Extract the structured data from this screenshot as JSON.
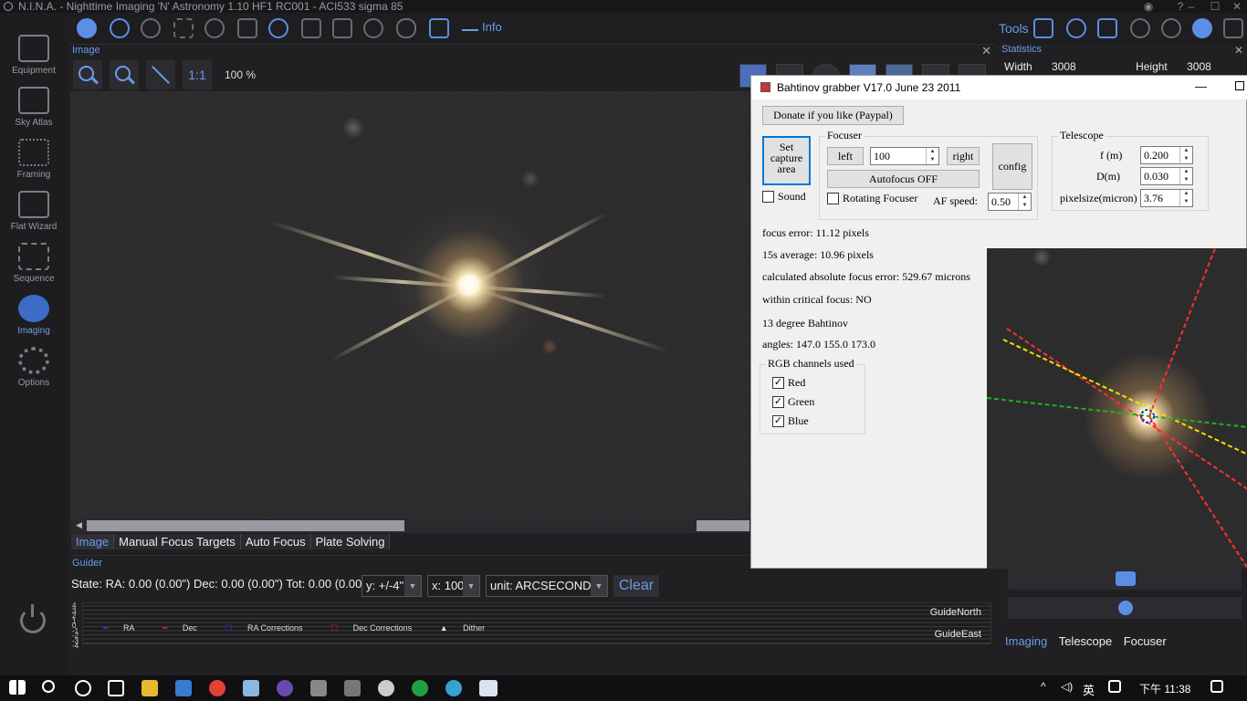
{
  "window": {
    "title": "N.I.N.A. - Nighttime Imaging 'N' Astronomy 1.10 HF1 RC001  -  ACI533 sigma 85"
  },
  "sidebar": {
    "items": [
      {
        "label": "Equipment",
        "icon": "equipment-icon"
      },
      {
        "label": "Sky Atlas",
        "icon": "sky-atlas-icon"
      },
      {
        "label": "Framing",
        "icon": "framing-icon"
      },
      {
        "label": "Flat Wizard",
        "icon": "flat-wizard-icon"
      },
      {
        "label": "Sequence",
        "icon": "sequence-icon"
      },
      {
        "label": "Imaging",
        "icon": "imaging-icon",
        "active": true
      },
      {
        "label": "Options",
        "icon": "options-icon"
      }
    ]
  },
  "toolbar": {
    "info_label": "Info",
    "tools_label": "Tools"
  },
  "image_panel": {
    "header": "Image",
    "zoom_one_label": "1:1",
    "zoom_level": "100 %",
    "tabs": [
      "Image",
      "Manual Focus Targets",
      "Auto Focus",
      "Plate Solving"
    ],
    "active_tab": "Image"
  },
  "guider": {
    "header": "Guider",
    "state": "State:",
    "ra": "RA: 0.00 (0.00\")",
    "dec": "Dec: 0.00 (0.00\")",
    "tot": "Tot: 0.00 (0.00\")",
    "y_select": "y: +/-4\"",
    "x_select": "x: 100",
    "unit_select": "unit: ARCSECONDS",
    "clear_label": "Clear",
    "y_ticks": [
      "4",
      "3",
      "2",
      "1",
      "0",
      "-1",
      "-2",
      "-3",
      "-4"
    ],
    "legend": [
      "RA",
      "Dec",
      "RA Corrections",
      "Dec Corrections",
      "Dither"
    ],
    "north_label": "GuideNorth",
    "east_label": "GuideEast"
  },
  "statistics": {
    "header": "Statistics",
    "width_label": "Width",
    "width_value": "3008",
    "height_label": "Height",
    "height_value": "3008"
  },
  "right_tabs": [
    "Imaging",
    "Telescope",
    "Focuser"
  ],
  "bahtinov": {
    "title": "Bahtinov grabber  V17.0 June 23 2011",
    "donate_label": "Donate if you like (Paypal)",
    "set_capture_label": "Set capture area",
    "sound_label": "Sound",
    "focuser_group": "Focuser",
    "left_label": "left",
    "step_value": "100",
    "right_label": "right",
    "autofocus_label": "Autofocus OFF",
    "config_label": "config",
    "rotating_label": "Rotating Focuser",
    "af_speed_label": "AF speed:",
    "af_speed_value": "0.50",
    "telescope_group": "Telescope",
    "f_label": "f (m)",
    "f_value": "0.200",
    "d_label": "D(m)",
    "d_value": "0.030",
    "pixelsize_label": "pixelsize(micron)",
    "pixelsize_value": "3.76",
    "focus_error": "focus error: 11.12 pixels",
    "average": "15s average: 10.96 pixels",
    "absolute_error": "calculated absolute focus error: 529.67 microns",
    "critical": "within critical focus: NO",
    "mask_type": "13 degree Bahtinov",
    "angles": "angles: 147.0 155.0 173.0",
    "rgb_group": "RGB channels used",
    "channels": [
      {
        "label": "Red",
        "checked": true
      },
      {
        "label": "Green",
        "checked": true
      },
      {
        "label": "Blue",
        "checked": true
      }
    ]
  },
  "taskbar": {
    "ime": "英",
    "time": "下午 11:38"
  }
}
